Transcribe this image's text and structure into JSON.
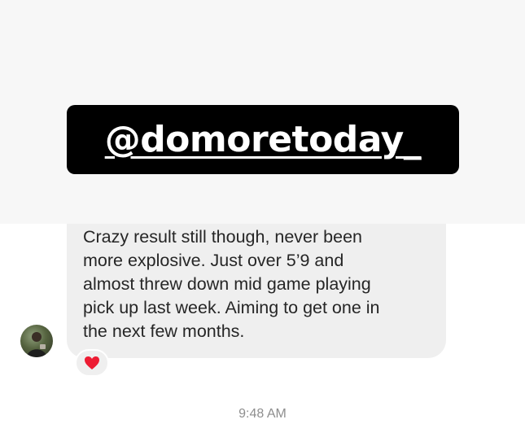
{
  "overlay": {
    "handle": "@domoretoday_"
  },
  "message": {
    "lines": [
      "Crazy result still though, never been",
      "more explosive. Just over 5’9 and",
      "almost threw down mid game playing",
      "pick up last week. Aiming to get one in",
      "the next few months."
    ],
    "reaction_icon": "heart-icon",
    "reaction_color": "#ed1c33"
  },
  "sender": {
    "avatar_icon": "avatar"
  },
  "timestamp": "9:48 AM",
  "colors": {
    "band": "#f7f7f7",
    "bubble": "#efefef",
    "text": "#262626",
    "timestamp": "#8e8e8e"
  }
}
